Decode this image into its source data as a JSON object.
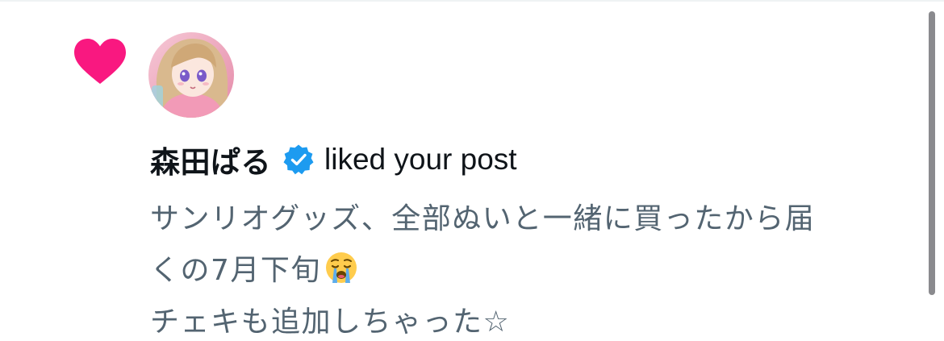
{
  "notification": {
    "type_icon": "heart-icon",
    "user": {
      "display_name": "森田ぱる",
      "verified": true,
      "avatar": "avatar-anime-girl"
    },
    "action": "liked your post",
    "post_text_lines": [
      "サンリオグッズ、全部ぬいと一緒に買ったから届",
      "くの7月下旬",
      "チェキも追加しちゃった☆"
    ],
    "post_emoji": "crying-face-emoji"
  },
  "colors": {
    "heart": "#f91880",
    "verified": "#1d9bf0",
    "primary_text": "#0f1419",
    "secondary_text": "#536471"
  }
}
